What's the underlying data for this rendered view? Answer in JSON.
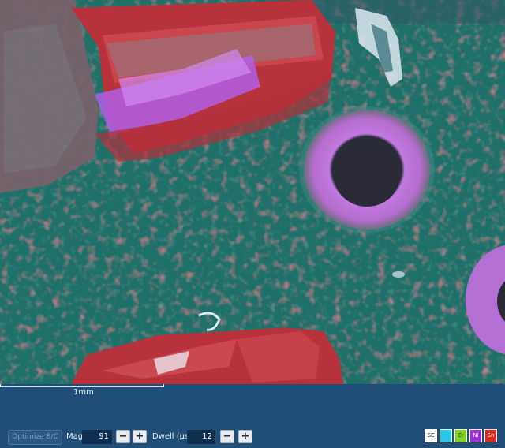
{
  "scale_bar": {
    "label": "1mm"
  },
  "toolbar": {
    "optimize_label": "Optimize B/C",
    "mag_label": "Mag",
    "mag_value": "91",
    "dwell_label": "Dwell (μs)",
    "dwell_value": "12",
    "minus": "−",
    "plus": "+"
  },
  "detectors": [
    {
      "label": "SE",
      "color": "#ffffff",
      "text_color": "#222222"
    },
    {
      "label": "C",
      "color": "#29c6e8",
      "text_color": "#29c6e8"
    },
    {
      "label": "Cr",
      "color": "#7ed321",
      "text_color": "#1d4d00"
    },
    {
      "label": "Ni",
      "color": "#9b30d9",
      "text_color": "#ffffff"
    },
    {
      "label": "Sn",
      "color": "#e0261f",
      "text_color": "#ffffff"
    }
  ],
  "colors": {
    "panel": "#1f4f78",
    "substrate": "#1d6f66",
    "tin": "#c8393f",
    "nickel": "#a94fd6"
  }
}
